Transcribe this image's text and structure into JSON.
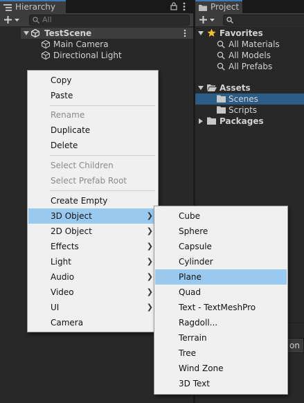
{
  "hierarchy": {
    "tab_label": "Hierarchy",
    "search_placeholder": "All",
    "scene_name": "TestScene",
    "items": [
      "Main Camera",
      "Directional Light"
    ]
  },
  "project": {
    "tab_label": "Project",
    "favorites": {
      "label": "Favorites",
      "items": [
        "All Materials",
        "All Models",
        "All Prefabs"
      ]
    },
    "assets": {
      "label": "Assets",
      "items": [
        "Scenes",
        "Scripts"
      ]
    },
    "packages": "Packages",
    "partial_field_text": "on P"
  },
  "context_menu": {
    "groups": [
      [
        {
          "label": "Copy"
        },
        {
          "label": "Paste"
        }
      ],
      [
        {
          "label": "Rename",
          "disabled": true
        },
        {
          "label": "Duplicate"
        },
        {
          "label": "Delete"
        }
      ],
      [
        {
          "label": "Select Children",
          "disabled": true
        },
        {
          "label": "Select Prefab Root",
          "disabled": true
        }
      ],
      [
        {
          "label": "Create Empty"
        },
        {
          "label": "3D Object",
          "submenu": true,
          "highlighted": true
        },
        {
          "label": "2D Object",
          "submenu": true
        },
        {
          "label": "Effects",
          "submenu": true
        },
        {
          "label": "Light",
          "submenu": true
        },
        {
          "label": "Audio",
          "submenu": true
        },
        {
          "label": "Video",
          "submenu": true
        },
        {
          "label": "UI",
          "submenu": true
        },
        {
          "label": "Camera"
        }
      ]
    ]
  },
  "submenu_3d": {
    "items": [
      "Cube",
      "Sphere",
      "Capsule",
      "Cylinder",
      "Plane",
      "Quad",
      "Text - TextMeshPro",
      "Ragdoll...",
      "Terrain",
      "Tree",
      "Wind Zone",
      "3D Text"
    ],
    "highlighted": "Plane"
  },
  "colors": {
    "panel_bg": "#282828",
    "header_bg": "#3c3c3c",
    "menu_bg": "#f0f0f0",
    "menu_highlight": "#99c9ef",
    "selection_blue": "#2c5d87",
    "star": "#f2c230"
  }
}
